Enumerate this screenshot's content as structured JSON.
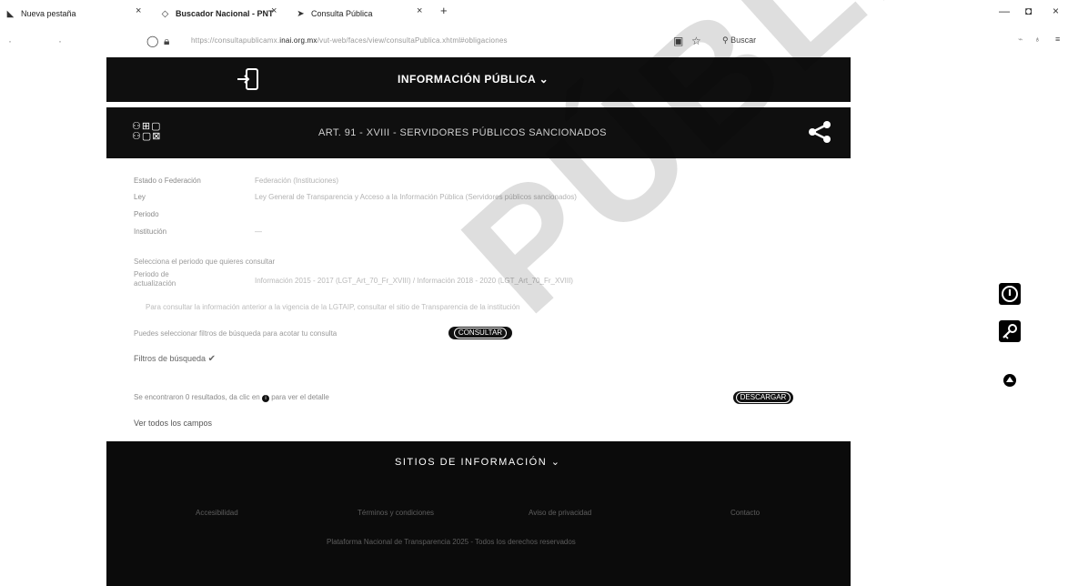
{
  "browser": {
    "tabs": [
      {
        "label": "Nueva pestaña",
        "icon": "new-tab-icon"
      },
      {
        "label": "Buscador Nacional - PNT",
        "icon": "pnt-icon"
      },
      {
        "label": "Consulta Pública",
        "icon": "consulta-icon"
      }
    ],
    "new_tab_symbol": "+",
    "close_symbol": "×",
    "window_controls": {
      "minimize": "—",
      "maximize": "◘",
      "close": "×"
    },
    "url_prefix": "https://consultapublicamx.",
    "url_domain": "inai.org.mx",
    "url_rest": "/vut-web/faces/view/consultaPublica.xhtml#obligaciones",
    "search_label": "Buscar"
  },
  "info_bar": {
    "title": "INFORMACIÓN PÚBLICA",
    "chevron": "⌄"
  },
  "article": {
    "title": "ART. 91 - XVIII - SERVIDORES PÚBLICOS SANCIONADOS"
  },
  "fields": [
    {
      "label": "Estado o Federación",
      "value": "Federación (Instituciones)"
    },
    {
      "label": "Ley",
      "value": "Ley General de Transparencia y Acceso a la Información Pública (Servidores públicos sancionados)"
    },
    {
      "label": "Periodo",
      "value": ""
    },
    {
      "label": "Institución",
      "value": "—"
    }
  ],
  "notes": {
    "period_note": "Selecciona el periodo que quieres consultar",
    "update_label": "Periodo de actualización",
    "update_value": "Información 2015 - 2017 (LGT_Art_70_Fr_XVIII) / Información 2018 - 2020 (LGT_Art_70_Fr_XVIII)",
    "extra_note": "Para consultar la información anterior a la vigencia de la LGTAIP, consultar el sitio de Transparencia de la institución",
    "consult_note": "Puedes seleccionar filtros de búsqueda para acotar tu consulta",
    "consult_button": "CONSULTAR",
    "filters_label": "Filtros de búsqueda",
    "results_note": "Se encontraron 0 resultados, da clic en",
    "results_note_2": "para ver el detalle",
    "download_button": "DESCARGAR",
    "all_fields": "Ver todos los campos"
  },
  "footer": {
    "title": "SITIOS DE INFORMACIÓN",
    "links": [
      "Accesibilidad",
      "Términos y condiciones",
      "Aviso de privacidad",
      "Contacto"
    ],
    "copyright": "Plataforma Nacional de Transparencia 2025 - Todos los derechos reservados"
  },
  "watermark": "PÚBLICA"
}
